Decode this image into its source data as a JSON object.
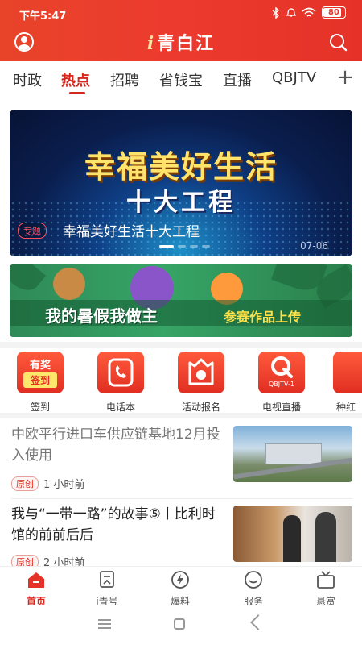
{
  "status_bar": {
    "time": "下午5:47",
    "battery": "80"
  },
  "header": {
    "logo_prefix": "i",
    "logo_text": "青白江"
  },
  "tabs": [
    {
      "label": "时政",
      "active": false
    },
    {
      "label": "热点",
      "active": true
    },
    {
      "label": "招聘",
      "active": false
    },
    {
      "label": "省钱宝",
      "active": false
    },
    {
      "label": "直播",
      "active": false
    },
    {
      "label": "QBJTV",
      "active": false
    }
  ],
  "banner": {
    "headline": "幸福美好生活",
    "subheadline": "十大工程",
    "tag": "专题",
    "caption": "幸福美好生活十大工程",
    "date": "07-06"
  },
  "promo": {
    "title": "我的暑假我做主",
    "subtitle": "参赛作品上传"
  },
  "shortcuts": [
    {
      "label": "签到",
      "icon_line1": "有奖",
      "icon_line2": "签到",
      "icon": "checkin-icon"
    },
    {
      "label": "电话本",
      "icon": "phone-book-icon"
    },
    {
      "label": "活动报名",
      "icon": "activity-signup-icon"
    },
    {
      "label": "电视直播",
      "icon": "tv-live-icon",
      "icon_text": "QBJTV-1"
    },
    {
      "label": "种红",
      "icon": "more-icon"
    }
  ],
  "news": [
    {
      "title": "中欧平行进口车供应链基地12月投入使用",
      "badge": "原创",
      "time": "1 小时前",
      "read": true
    },
    {
      "title": "我与“一带一路”的故事⑤丨比利时馆的前前后后",
      "badge": "原创",
      "time": "2 小时前",
      "read": false
    }
  ],
  "bottom_nav": [
    {
      "label": "首页",
      "icon": "home-icon",
      "active": true
    },
    {
      "label": "i青号",
      "icon": "iqing-icon",
      "active": false
    },
    {
      "label": "爆料",
      "icon": "lightning-icon",
      "active": false
    },
    {
      "label": "服务",
      "icon": "smile-icon",
      "active": false
    },
    {
      "label": "悬赏",
      "icon": "tv-icon",
      "active": false
    }
  ],
  "colors": {
    "brand_red": "#e53228",
    "active_red": "#d7261c"
  }
}
